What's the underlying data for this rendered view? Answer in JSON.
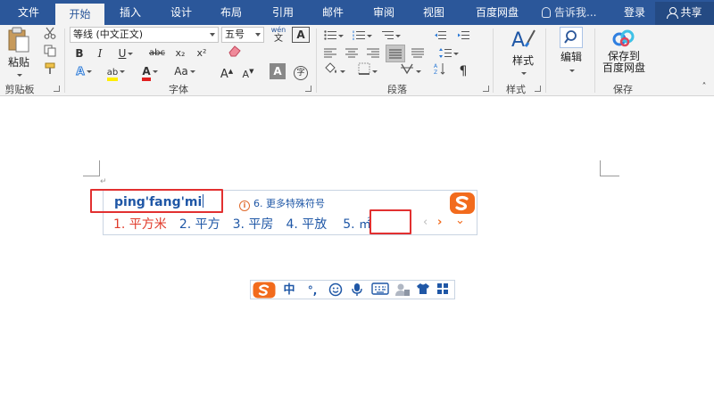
{
  "tabs": [
    {
      "label": "文件",
      "active": false
    },
    {
      "label": "开始",
      "active": true
    },
    {
      "label": "插入",
      "active": false
    },
    {
      "label": "设计",
      "active": false
    },
    {
      "label": "布局",
      "active": false
    },
    {
      "label": "引用",
      "active": false
    },
    {
      "label": "邮件",
      "active": false
    },
    {
      "label": "审阅",
      "active": false
    },
    {
      "label": "视图",
      "active": false
    },
    {
      "label": "百度网盘",
      "active": false
    }
  ],
  "tell_me": "告诉我...",
  "login": "登录",
  "share": "共享",
  "ribbon": {
    "paste_label": "粘贴",
    "font_name": "等线 (中文正文)",
    "font_size": "五号",
    "font_size_icon_text": "wén",
    "style_label": "样式",
    "edit_label": "编辑",
    "save_cloud_line1": "保存到",
    "save_cloud_line2": "百度网盘",
    "groups": {
      "clipboard": "剪贴板",
      "font": "字体",
      "paragraph": "段落",
      "styles": "样式",
      "save": "保存"
    },
    "font_buttons": {
      "bold": "B",
      "italic": "I",
      "underline": "U",
      "strike": "abc",
      "subscript": "x₂",
      "superscript": "x²",
      "grow": "A",
      "shrink": "A",
      "case": "Aa",
      "clear": "A",
      "enclose": "字",
      "highlight": "ab",
      "fontcolor": "A",
      "charshade": "A"
    }
  },
  "ime": {
    "pinyin": "ping'fang'mi",
    "hint": "6. 更多特殊符号",
    "candidates": [
      "1. 平方米",
      "2. 平方",
      "3. 平房",
      "4. 平放",
      "5. ㎡"
    ]
  },
  "imebar": {
    "lang": "中",
    "punct": "°,"
  },
  "colors": {
    "brand": "#2b579a",
    "ime_text": "#1f57a6",
    "first_candidate": "#e03a2a",
    "highlight_box": "#e23030",
    "sogou_orange": "#f26b1d"
  }
}
